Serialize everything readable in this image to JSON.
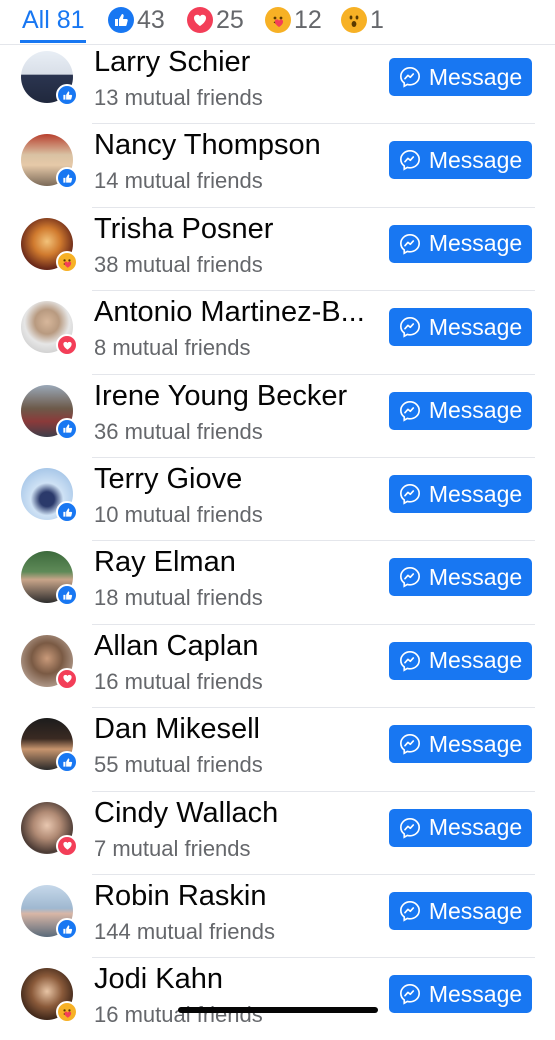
{
  "tabs": [
    {
      "label": "All 81",
      "icon": "",
      "active": true
    },
    {
      "label": "43",
      "icon": "like-icon"
    },
    {
      "label": "25",
      "icon": "love-icon"
    },
    {
      "label": "12",
      "icon": "care-icon"
    },
    {
      "label": "1",
      "icon": "wow-icon"
    }
  ],
  "colors": {
    "accent": "#1877f2",
    "love": "#f33e58",
    "care": "#f7b125",
    "muted": "#65676b"
  },
  "people": [
    {
      "name": "Larry Schier",
      "mutual": "13 mutual friends",
      "reaction": "like",
      "button": "Message"
    },
    {
      "name": "Nancy Thompson",
      "mutual": "14 mutual friends",
      "reaction": "like",
      "button": "Message"
    },
    {
      "name": "Trisha Posner",
      "mutual": "38 mutual friends",
      "reaction": "care",
      "button": "Message"
    },
    {
      "name": "Antonio Martinez-B...",
      "mutual": "8 mutual friends",
      "reaction": "love",
      "button": "Message"
    },
    {
      "name": "Irene Young Becker",
      "mutual": "36 mutual friends",
      "reaction": "like",
      "button": "Message"
    },
    {
      "name": "Terry Giove",
      "mutual": "10 mutual friends",
      "reaction": "like",
      "button": "Message"
    },
    {
      "name": "Ray Elman",
      "mutual": "18 mutual friends",
      "reaction": "like",
      "button": "Message"
    },
    {
      "name": "Allan Caplan",
      "mutual": "16 mutual friends",
      "reaction": "love",
      "button": "Message"
    },
    {
      "name": "Dan Mikesell",
      "mutual": "55 mutual friends",
      "reaction": "like",
      "button": "Message"
    },
    {
      "name": "Cindy Wallach",
      "mutual": "7 mutual friends",
      "reaction": "love",
      "button": "Message"
    },
    {
      "name": "Robin Raskin",
      "mutual": "144 mutual friends",
      "reaction": "like",
      "button": "Message"
    },
    {
      "name": "Jodi Kahn",
      "mutual": "16 mutual friends",
      "reaction": "care",
      "button": "Message"
    }
  ]
}
